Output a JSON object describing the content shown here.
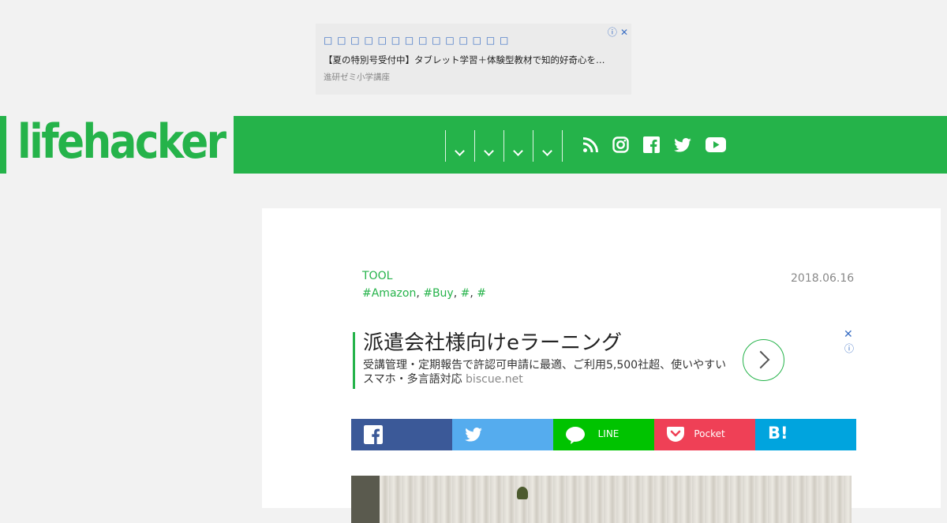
{
  "top_ad": {
    "title": "□ □ □ □ □ □ □ □ □ □ □ □ □ □",
    "description": "【夏の特別号受付中】タブレット学習＋体験型教材で知的好奇心を…",
    "source": "進研ゼミ小学講座",
    "info_icon": "ⓘ",
    "close_icon": "✕"
  },
  "header": {
    "logo_text": "lifehacker",
    "brand_color": "#25b34a",
    "menus": [
      "",
      "",
      "",
      ""
    ],
    "social": [
      "rss-icon",
      "instagram-icon",
      "facebook-icon",
      "twitter-icon",
      "youtube-icon"
    ]
  },
  "article": {
    "category": "TOOL",
    "tags": [
      "#Amazon",
      "#Buy",
      "#",
      "#"
    ],
    "date": "2018.06.16"
  },
  "inline_ad": {
    "headline": "派遣会社様向けeラーニング",
    "description": "受講管理・定期報告で許認可申請に最適、ご利用5,500社超、使いやすいスマホ・多言語対応",
    "domain": "biscue.net",
    "close_icon": "✕",
    "info_icon": "ⓘ"
  },
  "share": {
    "facebook": "",
    "twitter": "",
    "line": "LINE",
    "pocket": "Pocket",
    "hatena": "B!"
  },
  "colors": {
    "facebook": "#3b5998",
    "twitter": "#55acee",
    "line": "#00c300",
    "pocket": "#ef4056",
    "hatena": "#00a4de"
  }
}
